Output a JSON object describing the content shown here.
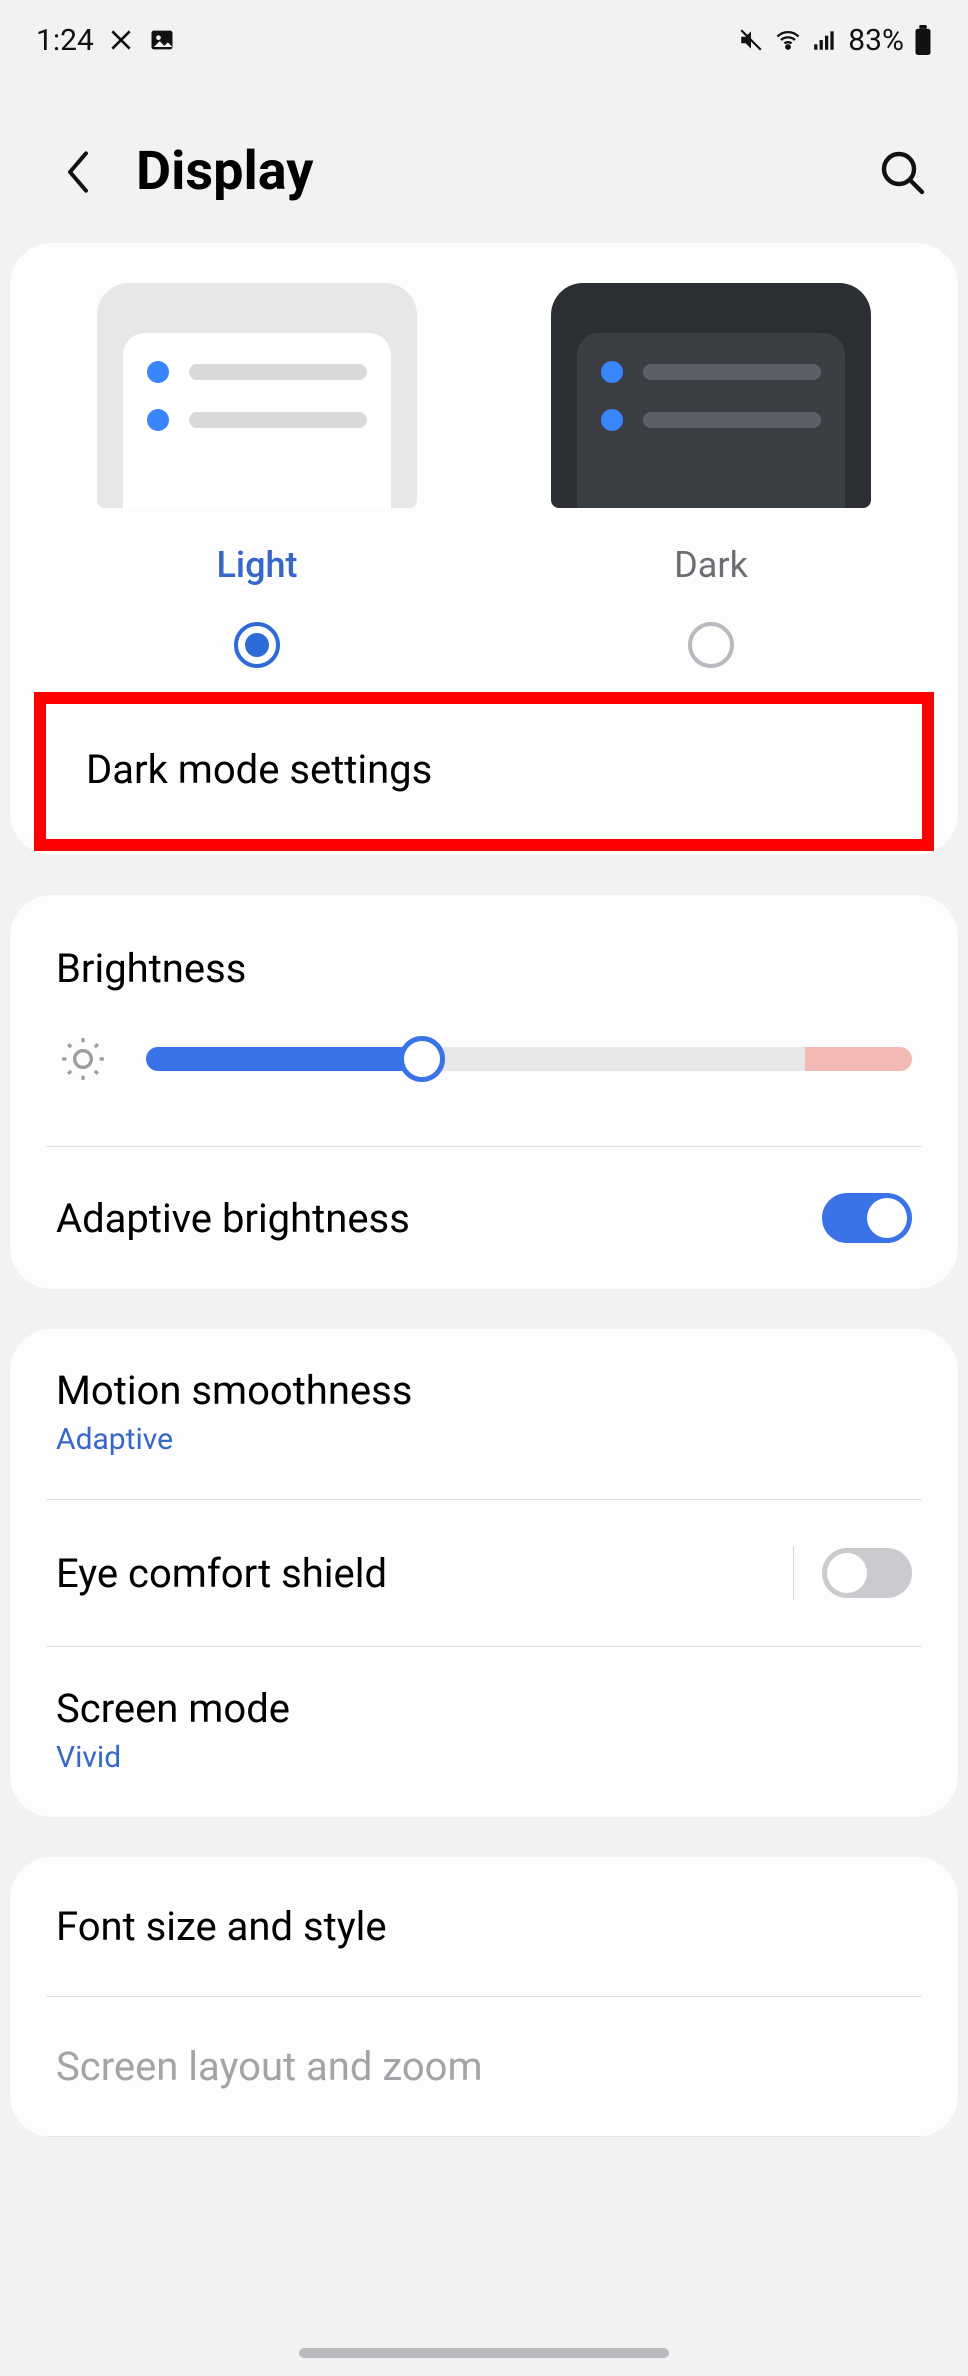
{
  "status": {
    "time": "1:24",
    "battery": "83%"
  },
  "header": {
    "title": "Display"
  },
  "theme": {
    "light_label": "Light",
    "dark_label": "Dark",
    "selected": "light"
  },
  "dark_mode_settings_label": "Dark mode settings",
  "brightness": {
    "title": "Brightness",
    "value_percent": 36,
    "adaptive_label": "Adaptive brightness",
    "adaptive_on": true
  },
  "display_options": {
    "motion_smoothness": {
      "label": "Motion smoothness",
      "value": "Adaptive"
    },
    "eye_comfort": {
      "label": "Eye comfort shield",
      "on": false
    },
    "screen_mode": {
      "label": "Screen mode",
      "value": "Vivid"
    }
  },
  "font": {
    "font_size_label": "Font size and style",
    "layout_zoom_label": "Screen layout and zoom"
  }
}
